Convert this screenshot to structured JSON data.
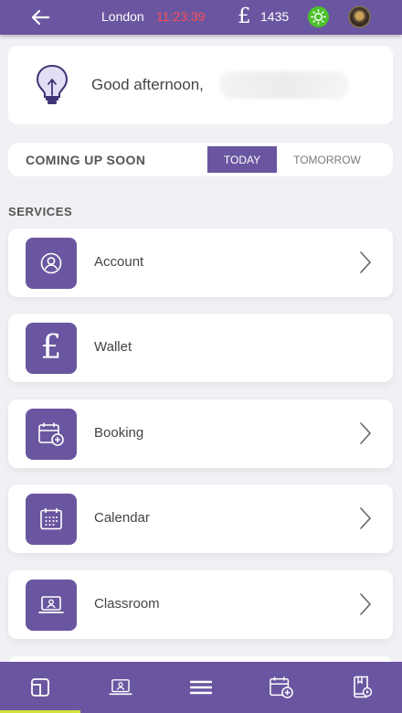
{
  "topbar": {
    "city": "London",
    "time": "11:23:39",
    "currency_symbol": "£",
    "balance": "1435",
    "colors": {
      "bar": "#6a56a0",
      "time": "#ff4d57",
      "status": "#4cc12a"
    }
  },
  "greeting": {
    "text": "Good afternoon,"
  },
  "coming_up": {
    "label": "COMING UP SOON",
    "tabs": [
      {
        "label": "TODAY",
        "active": true
      },
      {
        "label": "TOMORROW",
        "active": false
      }
    ]
  },
  "services": {
    "title": "SERVICES",
    "items": [
      {
        "label": "Account",
        "icon": "account-icon",
        "has_chevron": true
      },
      {
        "label": "Wallet",
        "icon": "pound-icon",
        "has_chevron": false
      },
      {
        "label": "Booking",
        "icon": "booking-icon",
        "has_chevron": true
      },
      {
        "label": "Calendar",
        "icon": "calendar-icon",
        "has_chevron": true
      },
      {
        "label": "Classroom",
        "icon": "classroom-icon",
        "has_chevron": true
      }
    ]
  },
  "bottom_nav": {
    "items": [
      {
        "icon": "dashboard-icon",
        "active": true
      },
      {
        "icon": "classroom-icon",
        "active": false
      },
      {
        "icon": "menu-icon",
        "active": false
      },
      {
        "icon": "booking-icon",
        "active": false
      },
      {
        "icon": "book-icon",
        "active": false
      }
    ],
    "active_color": "#d4e33b"
  }
}
